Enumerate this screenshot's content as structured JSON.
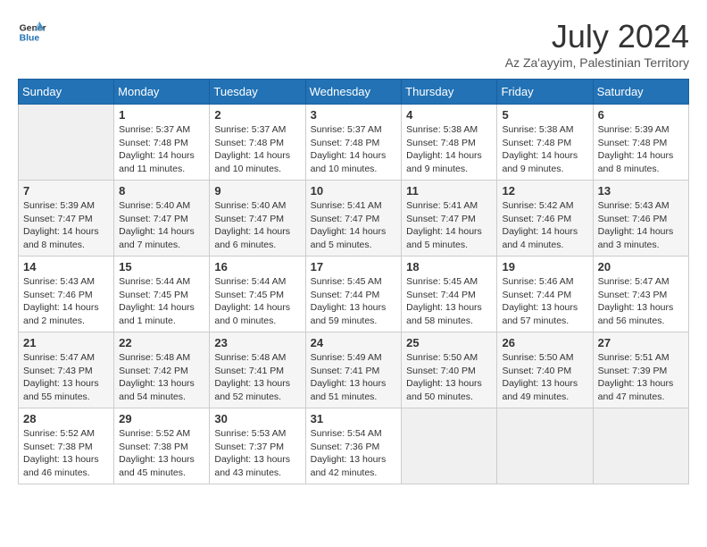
{
  "header": {
    "logo_line1": "General",
    "logo_line2": "Blue",
    "month_title": "July 2024",
    "subtitle": "Az Za'ayyim, Palestinian Territory"
  },
  "weekdays": [
    "Sunday",
    "Monday",
    "Tuesday",
    "Wednesday",
    "Thursday",
    "Friday",
    "Saturday"
  ],
  "weeks": [
    [
      {
        "day": "",
        "sunrise": "",
        "sunset": "",
        "daylight": ""
      },
      {
        "day": "1",
        "sunrise": "Sunrise: 5:37 AM",
        "sunset": "Sunset: 7:48 PM",
        "daylight": "Daylight: 14 hours and 11 minutes."
      },
      {
        "day": "2",
        "sunrise": "Sunrise: 5:37 AM",
        "sunset": "Sunset: 7:48 PM",
        "daylight": "Daylight: 14 hours and 10 minutes."
      },
      {
        "day": "3",
        "sunrise": "Sunrise: 5:37 AM",
        "sunset": "Sunset: 7:48 PM",
        "daylight": "Daylight: 14 hours and 10 minutes."
      },
      {
        "day": "4",
        "sunrise": "Sunrise: 5:38 AM",
        "sunset": "Sunset: 7:48 PM",
        "daylight": "Daylight: 14 hours and 9 minutes."
      },
      {
        "day": "5",
        "sunrise": "Sunrise: 5:38 AM",
        "sunset": "Sunset: 7:48 PM",
        "daylight": "Daylight: 14 hours and 9 minutes."
      },
      {
        "day": "6",
        "sunrise": "Sunrise: 5:39 AM",
        "sunset": "Sunset: 7:48 PM",
        "daylight": "Daylight: 14 hours and 8 minutes."
      }
    ],
    [
      {
        "day": "7",
        "sunrise": "Sunrise: 5:39 AM",
        "sunset": "Sunset: 7:47 PM",
        "daylight": "Daylight: 14 hours and 8 minutes."
      },
      {
        "day": "8",
        "sunrise": "Sunrise: 5:40 AM",
        "sunset": "Sunset: 7:47 PM",
        "daylight": "Daylight: 14 hours and 7 minutes."
      },
      {
        "day": "9",
        "sunrise": "Sunrise: 5:40 AM",
        "sunset": "Sunset: 7:47 PM",
        "daylight": "Daylight: 14 hours and 6 minutes."
      },
      {
        "day": "10",
        "sunrise": "Sunrise: 5:41 AM",
        "sunset": "Sunset: 7:47 PM",
        "daylight": "Daylight: 14 hours and 5 minutes."
      },
      {
        "day": "11",
        "sunrise": "Sunrise: 5:41 AM",
        "sunset": "Sunset: 7:47 PM",
        "daylight": "Daylight: 14 hours and 5 minutes."
      },
      {
        "day": "12",
        "sunrise": "Sunrise: 5:42 AM",
        "sunset": "Sunset: 7:46 PM",
        "daylight": "Daylight: 14 hours and 4 minutes."
      },
      {
        "day": "13",
        "sunrise": "Sunrise: 5:43 AM",
        "sunset": "Sunset: 7:46 PM",
        "daylight": "Daylight: 14 hours and 3 minutes."
      }
    ],
    [
      {
        "day": "14",
        "sunrise": "Sunrise: 5:43 AM",
        "sunset": "Sunset: 7:46 PM",
        "daylight": "Daylight: 14 hours and 2 minutes."
      },
      {
        "day": "15",
        "sunrise": "Sunrise: 5:44 AM",
        "sunset": "Sunset: 7:45 PM",
        "daylight": "Daylight: 14 hours and 1 minute."
      },
      {
        "day": "16",
        "sunrise": "Sunrise: 5:44 AM",
        "sunset": "Sunset: 7:45 PM",
        "daylight": "Daylight: 14 hours and 0 minutes."
      },
      {
        "day": "17",
        "sunrise": "Sunrise: 5:45 AM",
        "sunset": "Sunset: 7:44 PM",
        "daylight": "Daylight: 13 hours and 59 minutes."
      },
      {
        "day": "18",
        "sunrise": "Sunrise: 5:45 AM",
        "sunset": "Sunset: 7:44 PM",
        "daylight": "Daylight: 13 hours and 58 minutes."
      },
      {
        "day": "19",
        "sunrise": "Sunrise: 5:46 AM",
        "sunset": "Sunset: 7:44 PM",
        "daylight": "Daylight: 13 hours and 57 minutes."
      },
      {
        "day": "20",
        "sunrise": "Sunrise: 5:47 AM",
        "sunset": "Sunset: 7:43 PM",
        "daylight": "Daylight: 13 hours and 56 minutes."
      }
    ],
    [
      {
        "day": "21",
        "sunrise": "Sunrise: 5:47 AM",
        "sunset": "Sunset: 7:43 PM",
        "daylight": "Daylight: 13 hours and 55 minutes."
      },
      {
        "day": "22",
        "sunrise": "Sunrise: 5:48 AM",
        "sunset": "Sunset: 7:42 PM",
        "daylight": "Daylight: 13 hours and 54 minutes."
      },
      {
        "day": "23",
        "sunrise": "Sunrise: 5:48 AM",
        "sunset": "Sunset: 7:41 PM",
        "daylight": "Daylight: 13 hours and 52 minutes."
      },
      {
        "day": "24",
        "sunrise": "Sunrise: 5:49 AM",
        "sunset": "Sunset: 7:41 PM",
        "daylight": "Daylight: 13 hours and 51 minutes."
      },
      {
        "day": "25",
        "sunrise": "Sunrise: 5:50 AM",
        "sunset": "Sunset: 7:40 PM",
        "daylight": "Daylight: 13 hours and 50 minutes."
      },
      {
        "day": "26",
        "sunrise": "Sunrise: 5:50 AM",
        "sunset": "Sunset: 7:40 PM",
        "daylight": "Daylight: 13 hours and 49 minutes."
      },
      {
        "day": "27",
        "sunrise": "Sunrise: 5:51 AM",
        "sunset": "Sunset: 7:39 PM",
        "daylight": "Daylight: 13 hours and 47 minutes."
      }
    ],
    [
      {
        "day": "28",
        "sunrise": "Sunrise: 5:52 AM",
        "sunset": "Sunset: 7:38 PM",
        "daylight": "Daylight: 13 hours and 46 minutes."
      },
      {
        "day": "29",
        "sunrise": "Sunrise: 5:52 AM",
        "sunset": "Sunset: 7:38 PM",
        "daylight": "Daylight: 13 hours and 45 minutes."
      },
      {
        "day": "30",
        "sunrise": "Sunrise: 5:53 AM",
        "sunset": "Sunset: 7:37 PM",
        "daylight": "Daylight: 13 hours and 43 minutes."
      },
      {
        "day": "31",
        "sunrise": "Sunrise: 5:54 AM",
        "sunset": "Sunset: 7:36 PM",
        "daylight": "Daylight: 13 hours and 42 minutes."
      },
      {
        "day": "",
        "sunrise": "",
        "sunset": "",
        "daylight": ""
      },
      {
        "day": "",
        "sunrise": "",
        "sunset": "",
        "daylight": ""
      },
      {
        "day": "",
        "sunrise": "",
        "sunset": "",
        "daylight": ""
      }
    ]
  ]
}
